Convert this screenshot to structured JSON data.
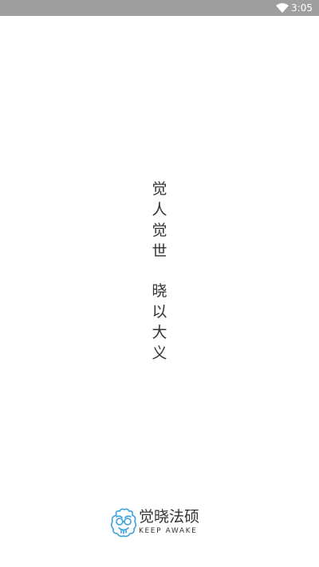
{
  "status_bar": {
    "time": "3:05",
    "wifi_icon": "wifi-icon"
  },
  "slogan": {
    "line1": [
      "觉",
      "人",
      "觉",
      "世"
    ],
    "line2": [
      "晓",
      "以",
      "大",
      "义"
    ]
  },
  "brand": {
    "name": "觉晓法硕",
    "tagline": "KEEP AWAKE",
    "logo_icon": "owl-logo-icon",
    "accent_color": "#3aa0dc"
  }
}
